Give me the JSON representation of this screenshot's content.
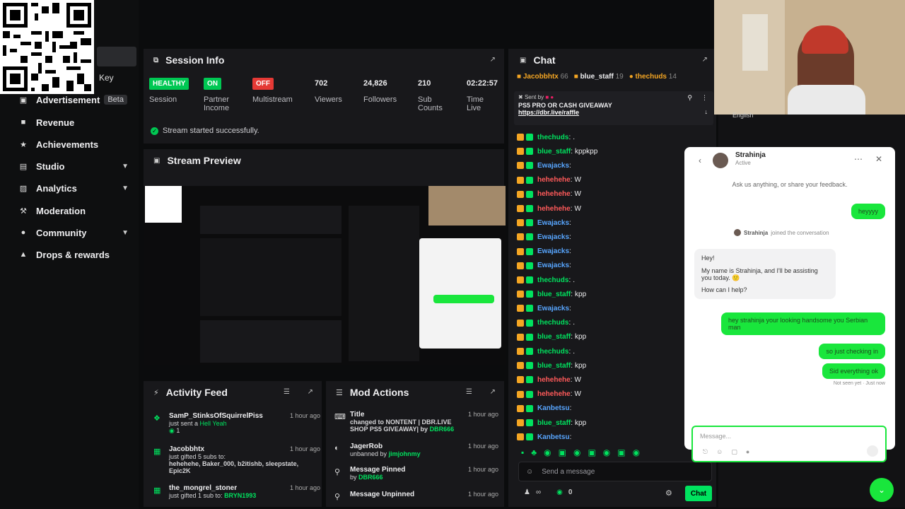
{
  "sidebar": {
    "key_label": "Key",
    "items": [
      {
        "label": "Advertisement",
        "icon": "ad-icon",
        "badge": "Beta"
      },
      {
        "label": "Revenue",
        "icon": "revenue-icon"
      },
      {
        "label": "Achievements",
        "icon": "trophy-icon"
      },
      {
        "label": "Studio",
        "icon": "studio-icon",
        "chevron": true
      },
      {
        "label": "Analytics",
        "icon": "analytics-icon",
        "chevron": true
      },
      {
        "label": "Moderation",
        "icon": "wrench-icon"
      },
      {
        "label": "Community",
        "icon": "community-icon",
        "chevron": true
      },
      {
        "label": "Drops & rewards",
        "icon": "drops-icon"
      }
    ]
  },
  "session": {
    "title": "Session Info",
    "stats": [
      {
        "value": "HEALTHY",
        "label": "Session",
        "badge_color": "#00c853"
      },
      {
        "value": "ON",
        "label": "Partner Income",
        "badge_color": "#00c853"
      },
      {
        "value": "OFF",
        "label": "Multistream",
        "badge_color": "#e53935"
      },
      {
        "value": "702",
        "label": "Viewers"
      },
      {
        "value": "24,826",
        "label": "Followers"
      },
      {
        "value": "210",
        "label": "Sub Counts"
      },
      {
        "value": "02:22:57",
        "label": "Time Live"
      }
    ],
    "status": "Stream started successfully."
  },
  "preview": {
    "title": "Stream Preview"
  },
  "activity": {
    "title": "Activity Feed",
    "items": [
      {
        "name": "SamP_StinksOfSquirrelPiss",
        "time": "1 hour ago",
        "line": "just sent a",
        "highlight": "Hell Yeah",
        "extra": "1"
      },
      {
        "name": "Jacobbhtx",
        "time": "1 hour ago",
        "line": "just gifted 5 subs to:",
        "highlight": "hehehehe, Baker_000, b2itishb, sleepstate, Epic2K"
      },
      {
        "name": "the_mongrel_stoner",
        "time": "1 hour ago",
        "line": "just gifted 1 sub to:",
        "highlight": "BRYN1993"
      }
    ]
  },
  "mod": {
    "title": "Mod Actions",
    "items": [
      {
        "name": "Title",
        "time": "1 hour ago",
        "line": "changed to NONTENT | DBR.LIVE SHOP PS5 GIVEAWAY| by",
        "highlight": "DBR666"
      },
      {
        "name": "JagerRob",
        "time": "1 hour ago",
        "line": "unbanned by",
        "highlight": "jimjohnmy"
      },
      {
        "name": "Message Pinned",
        "time": "1 hour ago",
        "line": "by",
        "highlight": "DBR666"
      },
      {
        "name": "Message Unpinned",
        "time": "1 hour ago",
        "line": "",
        "highlight": ""
      }
    ]
  },
  "chat": {
    "title": "Chat",
    "top_users": [
      {
        "name": "Jacobbhtx",
        "count": "66"
      },
      {
        "name": "blue_staff",
        "count": "19"
      },
      {
        "name": "thechuds",
        "count": "14"
      }
    ],
    "pinned": {
      "sent_by": "Sent by",
      "text": "PS5 PRO OR CASH GIVEAWAY",
      "link": "https://dbr.live/raffle"
    },
    "messages": [
      {
        "user": "thechuds",
        "msg": ".",
        "color": "#00e35f"
      },
      {
        "user": "blue_staff",
        "msg": "kppkpp",
        "color": "#00e35f"
      },
      {
        "user": "Ewajacks",
        "msg": "",
        "color": "#58a6ff"
      },
      {
        "user": "hehehehe",
        "msg": "W",
        "color": "#ff5a5a"
      },
      {
        "user": "hehehehe",
        "msg": "W",
        "color": "#ff5a5a"
      },
      {
        "user": "hehehehe",
        "msg": "W",
        "color": "#ff5a5a"
      },
      {
        "user": "Ewajacks",
        "msg": "",
        "color": "#58a6ff"
      },
      {
        "user": "Ewajacks",
        "msg": "",
        "color": "#58a6ff"
      },
      {
        "user": "Ewajacks",
        "msg": "",
        "color": "#58a6ff"
      },
      {
        "user": "Ewajacks",
        "msg": "",
        "color": "#58a6ff"
      },
      {
        "user": "thechuds",
        "msg": ".",
        "color": "#00e35f"
      },
      {
        "user": "blue_staff",
        "msg": "kpp",
        "color": "#00e35f"
      },
      {
        "user": "Ewajacks",
        "msg": "",
        "color": "#58a6ff"
      },
      {
        "user": "thechuds",
        "msg": ".",
        "color": "#00e35f"
      },
      {
        "user": "blue_staff",
        "msg": "kpp",
        "color": "#00e35f"
      },
      {
        "user": "thechuds",
        "msg": ".",
        "color": "#00e35f"
      },
      {
        "user": "blue_staff",
        "msg": "kpp",
        "color": "#00e35f"
      },
      {
        "user": "hehehehe",
        "msg": "W",
        "color": "#ff5a5a"
      },
      {
        "user": "hehehehe",
        "msg": "W",
        "color": "#ff5a5a"
      },
      {
        "user": "Kanbetsu",
        "msg": "",
        "color": "#58a6ff"
      },
      {
        "user": "blue_staff",
        "msg": "kpp",
        "color": "#00e35f"
      },
      {
        "user": "Kanbetsu",
        "msg": "",
        "color": "#58a6ff"
      }
    ],
    "input_placeholder": "Send a message",
    "points": "0",
    "chat_button": "Chat"
  },
  "support": {
    "agent": "Strahinja",
    "status": "Active",
    "intro": "Ask us anything, or share your feedback.",
    "msg1": "heyyyy",
    "joined_name": "Strahinja",
    "joined_text": "joined the conversation",
    "agent_msg1": "Hey!",
    "agent_msg2": "My name is Strahinja, and I'll be assisting you today. 🙂",
    "agent_msg3": "How can I help?",
    "msg2": "hey strahinja your looking handsome you Serbian man",
    "msg3": "so just checking in",
    "msg4": "Sid everything ok",
    "seen": "Not seen yet · Just now",
    "placeholder": "Message...",
    "lang": "English"
  },
  "colors": {
    "accent": "#00e35f",
    "danger": "#e53935",
    "panel": "#18181b"
  }
}
